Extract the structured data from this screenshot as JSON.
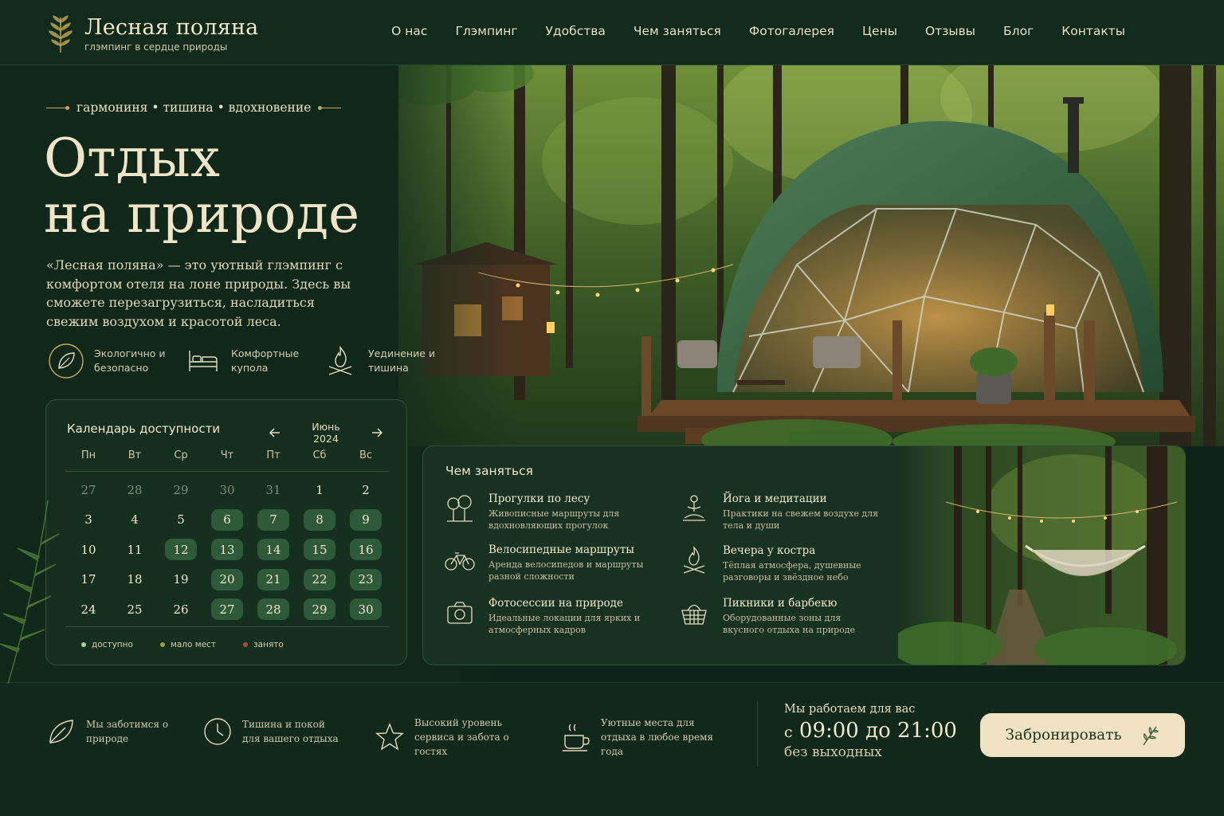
{
  "brand": {
    "name": "Лесная поляна",
    "tagline": "глэмпинг в сердце природы"
  },
  "nav": {
    "items": [
      "О нас",
      "Глэмпинг",
      "Удобства",
      "Чем заняться",
      "Фотогалерея",
      "Цены",
      "Отзывы",
      "Блог",
      "Контакты"
    ]
  },
  "hero": {
    "tagline": "гармониня • тишина • вдохновение",
    "title_line1": "Отдых",
    "title_line2": "на природе",
    "text": "«Лесная поляна» — это уютный глэмпинг с комфортом отеля на лоне природы. Здесь вы сможете перезагрузиться, насладиться свежим воздухом и красотой леса.",
    "features": [
      {
        "icon": "leaf-icon",
        "label": "Экологично и безопасно"
      },
      {
        "icon": "bed-icon",
        "label": "Комфортные купола"
      },
      {
        "icon": "campfire-icon",
        "label": "Уединение и тишина"
      }
    ]
  },
  "calendar": {
    "title": "Календарь доступности",
    "month": "Июнь 2024",
    "weekdays": [
      "Пн",
      "Вт",
      "Ср",
      "Чт",
      "Пт",
      "Сб",
      "Вс"
    ],
    "days": [
      {
        "d": "27",
        "s": "muted"
      },
      {
        "d": "28",
        "s": "muted"
      },
      {
        "d": "29",
        "s": "muted"
      },
      {
        "d": "30",
        "s": "muted"
      },
      {
        "d": "31",
        "s": "muted"
      },
      {
        "d": "1",
        "s": ""
      },
      {
        "d": "2",
        "s": ""
      },
      {
        "d": "3",
        "s": ""
      },
      {
        "d": "4",
        "s": ""
      },
      {
        "d": "5",
        "s": ""
      },
      {
        "d": "6",
        "s": "avail"
      },
      {
        "d": "7",
        "s": "avail"
      },
      {
        "d": "8",
        "s": "avail"
      },
      {
        "d": "9",
        "s": "avail"
      },
      {
        "d": "10",
        "s": ""
      },
      {
        "d": "11",
        "s": ""
      },
      {
        "d": "12",
        "s": "avail"
      },
      {
        "d": "13",
        "s": "avail"
      },
      {
        "d": "14",
        "s": "avail"
      },
      {
        "d": "15",
        "s": "avail"
      },
      {
        "d": "16",
        "s": "avail"
      },
      {
        "d": "17",
        "s": ""
      },
      {
        "d": "18",
        "s": ""
      },
      {
        "d": "19",
        "s": ""
      },
      {
        "d": "20",
        "s": "avail"
      },
      {
        "d": "21",
        "s": "avail"
      },
      {
        "d": "22",
        "s": "avail"
      },
      {
        "d": "23",
        "s": "avail"
      },
      {
        "d": "24",
        "s": ""
      },
      {
        "d": "25",
        "s": ""
      },
      {
        "d": "26",
        "s": ""
      },
      {
        "d": "27",
        "s": "avail"
      },
      {
        "d": "28",
        "s": "avail"
      },
      {
        "d": "29",
        "s": "avail"
      },
      {
        "d": "30",
        "s": "avail"
      }
    ],
    "legend": [
      {
        "label": "доступно",
        "color": "#b8c9a8"
      },
      {
        "label": "мало мест",
        "color": "#a89a3c"
      },
      {
        "label": "занято",
        "color": "#b04a2e"
      }
    ]
  },
  "activities": {
    "title": "Чем заняться",
    "items": [
      {
        "icon": "trees-icon",
        "name": "Прогулки по лесу",
        "desc": "Живописные маршруты для вдохновляющих прогулок"
      },
      {
        "icon": "meditation-icon",
        "name": "Йога и медитации",
        "desc": "Практики на свежем воздухе для тела и души"
      },
      {
        "icon": "bicycle-icon",
        "name": "Велосипедные маршруты",
        "desc": "Аренда велосипедов и маршруты разной сложности"
      },
      {
        "icon": "campfire-icon",
        "name": "Вечера у костра",
        "desc": "Тёплая атмосфера, душевные разговоры и звёздное небо"
      },
      {
        "icon": "camera-icon",
        "name": "Фотосессии на природе",
        "desc": "Идеальные локации для ярких и атмосферных кадров"
      },
      {
        "icon": "basket-icon",
        "name": "Пикники и барбекю",
        "desc": "Оборудованные зоны для вкусного отдыха на природе"
      }
    ]
  },
  "perks": [
    {
      "icon": "leaf-icon",
      "text": "Мы заботимся о природе"
    },
    {
      "icon": "clock-icon",
      "text": "Тишина и покой для вашего отдыха"
    },
    {
      "icon": "star-icon",
      "text": "Высокий уровень сервиса и забота о гостях"
    },
    {
      "icon": "cup-icon",
      "text": "Уютные места для отдыха в любое время года"
    }
  ],
  "hours": {
    "label": "Мы работаем для вас",
    "prefix": "с",
    "range": "09:00 до 21:00",
    "note": "без выходных"
  },
  "cta": {
    "label": "Забронировать"
  },
  "colors": {
    "background": "#0f2418",
    "accent": "#c7a957",
    "cream": "#efe3c3",
    "available": "#2f5a3a"
  }
}
